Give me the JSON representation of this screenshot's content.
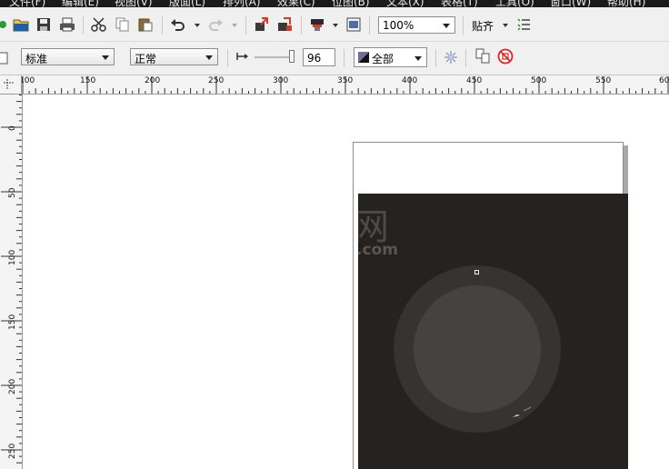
{
  "menubar": {
    "items": [
      "文件(F)",
      "编辑(E)",
      "视图(V)",
      "版面(L)",
      "排列(A)",
      "效果(C)",
      "位图(B)",
      "文本(X)",
      "表格(T)",
      "工具(O)",
      "窗口(W)",
      "帮助(H)"
    ]
  },
  "toolbar": {
    "zoom_value": "100%",
    "snap_label": "贴齐"
  },
  "property_bar": {
    "style_value": "标准",
    "mode_value": "正常",
    "width_value": "96",
    "fill_value": "全部"
  },
  "ruler": {
    "h_labels": [
      "100",
      "150",
      "200",
      "250",
      "300",
      "350",
      "400",
      "450",
      "500",
      "550",
      "600"
    ],
    "v_labels": [
      "0",
      "50",
      "100",
      "150",
      "200",
      "250"
    ]
  },
  "canvas": {
    "watermark_big": "网",
    "watermark_small": ".com"
  },
  "colors": {
    "image_bg": "#25231f",
    "outer_ring": "#3a3836",
    "inner_ring": "#484644"
  }
}
